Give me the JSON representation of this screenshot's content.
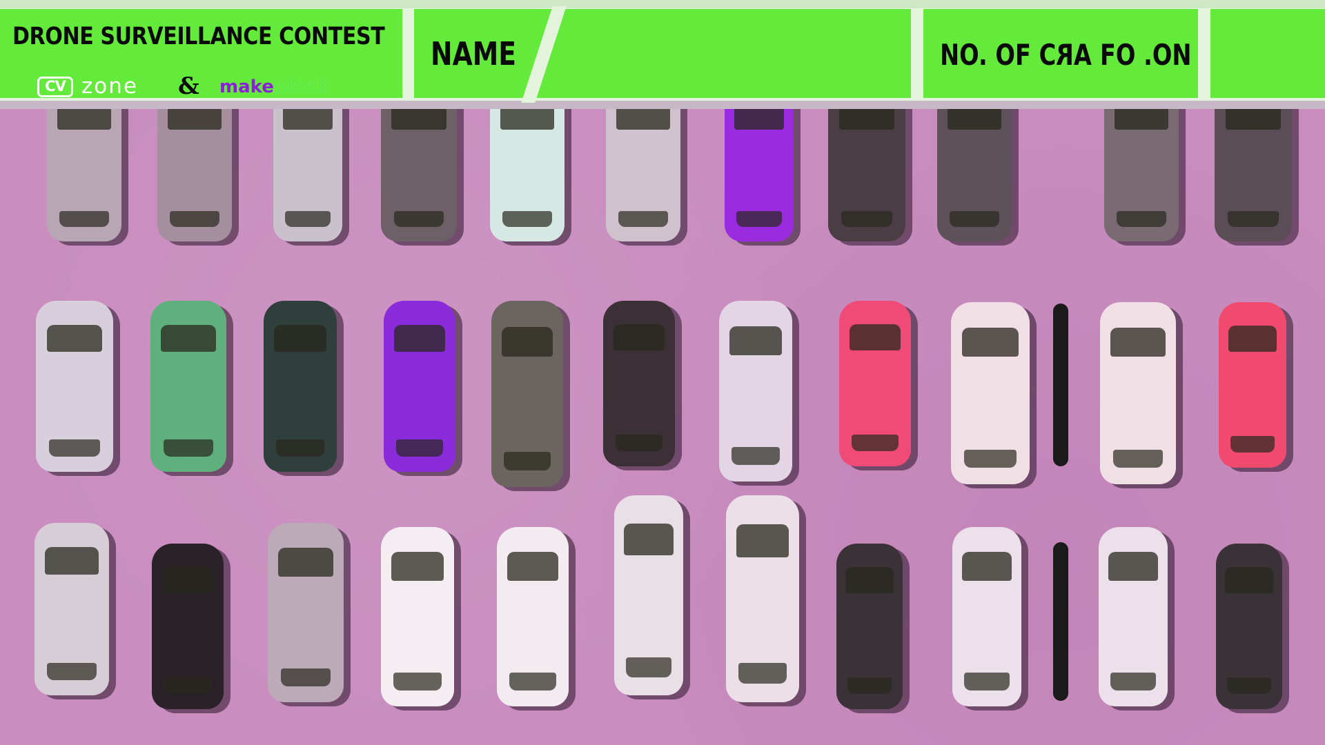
{
  "header": {
    "title": "DRONE SURVEILLANCE CONTEST",
    "logo_left_badge": "CV",
    "logo_left_word": "zone",
    "ampersand": "&",
    "logo_right_part1": "make",
    "logo_right_part2": "block",
    "name_label": "NAME",
    "name_value": "",
    "count_label_prefix": "NO. OF C",
    "count_label_mirrored": "AR",
    "count_label_suffix": " FO .ON",
    "count_value": ""
  },
  "colors": {
    "panel_green": "#63ea3b",
    "lot_pink": "#c98dbf",
    "makeblock_purple": "#8a1fd6"
  },
  "feed": {
    "description_icon": "aerial-parking-lot-video"
  }
}
